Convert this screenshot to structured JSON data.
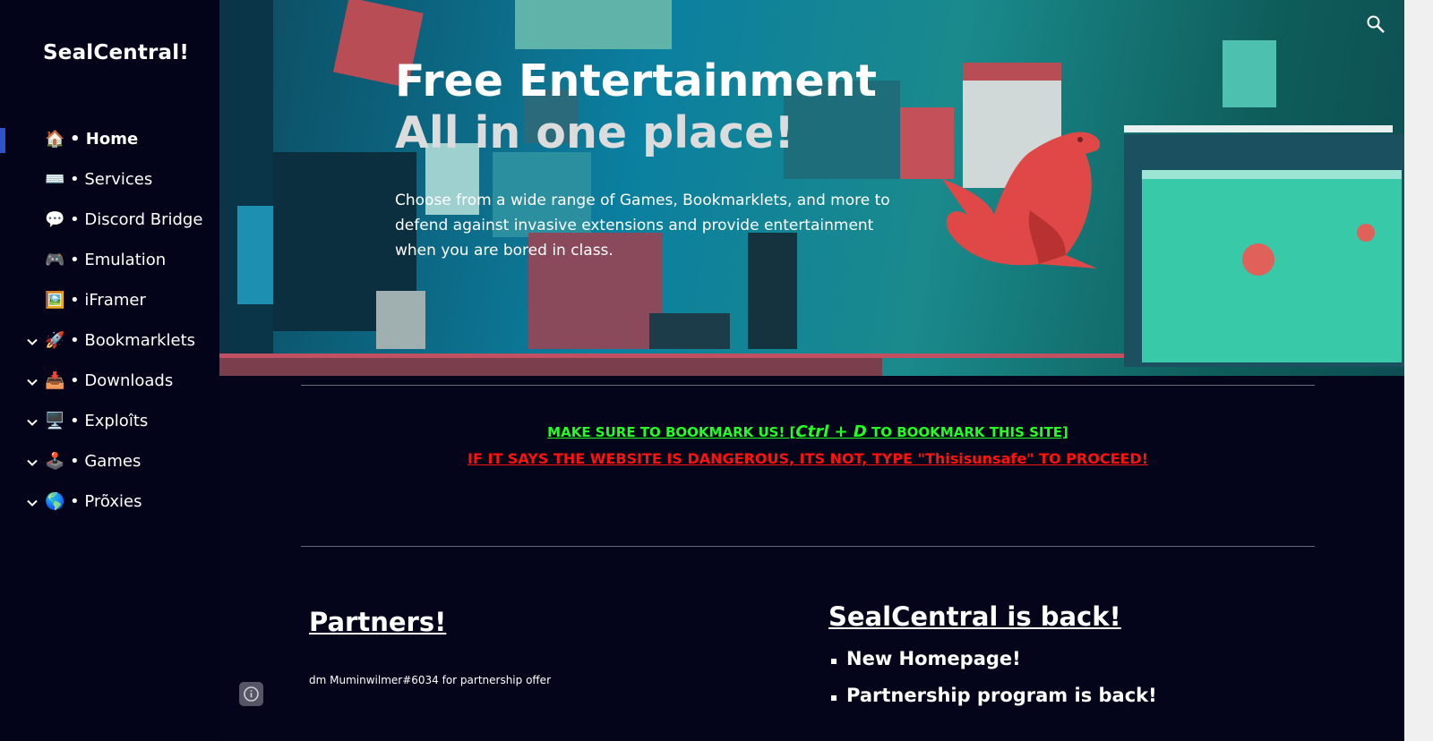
{
  "sidebar": {
    "site_title": "SealCentral!",
    "items": [
      {
        "emoji": "🏠",
        "label": "Home"
      },
      {
        "emoji": "⌨️",
        "label": "Services"
      },
      {
        "emoji": "💬",
        "label": "Discord Bridge"
      },
      {
        "emoji": "🎮",
        "label": "Emulation"
      },
      {
        "emoji": "🖼️",
        "label": "iFramer"
      },
      {
        "emoji": "🚀",
        "label": "Bookmarklets"
      },
      {
        "emoji": "📥",
        "label": "Downloads"
      },
      {
        "emoji": "🖥️",
        "label": "Exploîts"
      },
      {
        "emoji": "🕹️",
        "label": "Games"
      },
      {
        "emoji": "🌎",
        "label": "Prõxies"
      }
    ],
    "bullet": "•",
    "active_item": "Home",
    "expandable_items": [
      "Bookmarklets",
      "Downloads",
      "Exploîts",
      "Games",
      "Prõxies"
    ]
  },
  "hero": {
    "title_line1": "Free Entertainment",
    "title_line2": "All in one place!",
    "description": "Choose from a wide range of Games, Bookmarklets, and more to defend against invasive extensions and provide entertainment when you are bored in class."
  },
  "notices": {
    "bookmark_prefix": "MAKE SURE TO BOOKMARK US! [",
    "bookmark_shortcut": "Ctrl + D",
    "bookmark_suffix": " TO BOOKMARK THIS SITE]",
    "danger_warning": "IF IT SAYS THE WEBSITE IS DANGEROUS, ITS NOT, TYPE \"Thisisunsafe\" TO PROCEED!"
  },
  "partners": {
    "heading": "Partners!",
    "text": "dm Muminwilmer#6034 for partnership offer"
  },
  "news": {
    "heading": "SealCentral is back!",
    "items": [
      "New Homepage!",
      "Partnership program is back!"
    ]
  },
  "icons": {
    "search": "search-icon",
    "info": "info-icon",
    "chevron": "chevron-down-icon",
    "seal_logo": "seal-logo"
  },
  "colors": {
    "background": "#04041a",
    "sidebar": "#03031a",
    "accent": "#2f54c9",
    "notice_green": "#22ff22",
    "notice_red": "#ff1111",
    "seal": "#e04848"
  }
}
